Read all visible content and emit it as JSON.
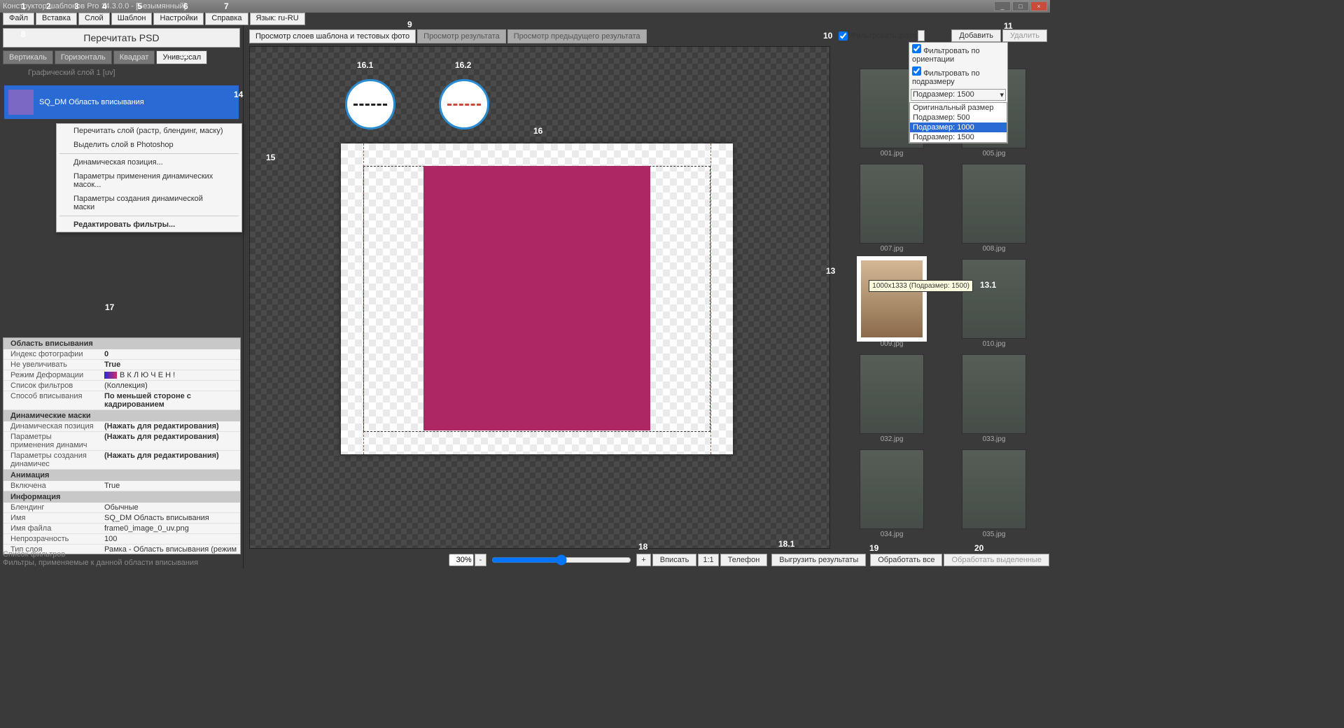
{
  "title": "Конструктор шаблонов Pro 14.3.0.0 - [Безымянный]",
  "menu": [
    "Файл",
    "Вставка",
    "Слой",
    "Шаблон",
    "Настройки",
    "Справка",
    "Язык: ru-RU"
  ],
  "reread_btn": "Перечитать PSD",
  "orient_tabs": [
    "Вертикаль",
    "Горизонталь",
    "Квадрат",
    "Универсал"
  ],
  "orient_active": 3,
  "layer_caption": "Графический слой 1 [uv]",
  "layer_name": "SQ_DM Область вписывания",
  "context_menu": [
    "Перечитать слой (растр, блендинг, маску)",
    "Выделить слой в Photoshop",
    "Динамическая позиция...",
    "Параметры применения динамических масок...",
    "Параметры создания динамической маски"
  ],
  "context_menu_last": "Редактировать фильтры...",
  "props": {
    "g1": "Область вписывания",
    "r1k": "Индекс фотографии",
    "r1v": "0",
    "r2k": "Не увеличивать",
    "r2v": "True",
    "r3k": "Режим Деформации",
    "r3v": "В К Л Ю Ч Е Н !",
    "r4k": "Список фильтров",
    "r4v": "(Коллекция)",
    "r5k": "Способ вписывания",
    "r5v": "По меньшей стороне с кадрированием",
    "g2": "Динамические маски",
    "r6k": "Динамическая позиция",
    "r6v": "(Нажать для редактирования)",
    "r7k": "Параметры применения динамич",
    "r7v": "(Нажать для редактирования)",
    "r8k": "Параметры создания динамичес",
    "r8v": "(Нажать для редактирования)",
    "g3": "Анимация",
    "r9k": "Включена",
    "r9v": "True",
    "g4": "Информация",
    "r10k": "Блендинг",
    "r10v": "Обычные",
    "r11k": "Имя",
    "r11v": "SQ_DM Область вписывания",
    "r12k": "Имя файла",
    "r12v": "frame0_image_0_uv.png",
    "r13k": "Непрозрачность",
    "r13v": "100",
    "r14k": "Тип слоя",
    "r14v": "Рамка - Область вписывания (режим деформации)"
  },
  "props_footer_t": "Список фильтров",
  "props_footer_s": "Фильтры, применяемые к данной области вписывания",
  "view_tabs": [
    "Просмотр слоев шаблона и тестовых фото",
    "Просмотр результата",
    "Просмотр предыдущего результата"
  ],
  "filter_check": "Фильтровать фото",
  "add_btn": "Добавить",
  "del_btn": "Удалить",
  "filter_popup": {
    "c1": "Фильтровать по ориентации",
    "c2": "Фильтровать по подразмеру",
    "sel": "Подразмер: 1500",
    "opts": [
      "Оригинальный размер",
      "Подразмер: 500",
      "Подразмер: 1000",
      "Подразмер: 1500"
    ],
    "opt_sel": 2
  },
  "thumbs": [
    "001.jpg",
    "005.jpg",
    "007.jpg",
    "008.jpg",
    "009.jpg",
    "010.jpg",
    "032.jpg",
    "033.jpg",
    "034.jpg",
    "035.jpg"
  ],
  "thumb_sel": 4,
  "tooltip": "1000x1333 (Подразмер: 1500)",
  "zoom": "30%",
  "bottom": {
    "fit": "Вписать",
    "one": "1:1",
    "phone": "Телефон",
    "unload": "Выгрузить результаты",
    "proc_all": "Обработать все",
    "proc_sel": "Обработать выделенные"
  },
  "annot": {
    "a1": "1",
    "a2": "2",
    "a3": "3",
    "a4": "4",
    "a5": "5",
    "a6": "6",
    "a7": "7",
    "a8": "8",
    "a9": "9",
    "a10": "10",
    "a11": "11",
    "a12": "12",
    "a13": "13",
    "a131": "13.1",
    "a14": "14",
    "a15": "15",
    "a16": "16",
    "a161": "16.1",
    "a162": "16.2",
    "a17": "17",
    "a18": "18",
    "a181": "18.1",
    "a19": "19",
    "a20": "20"
  }
}
